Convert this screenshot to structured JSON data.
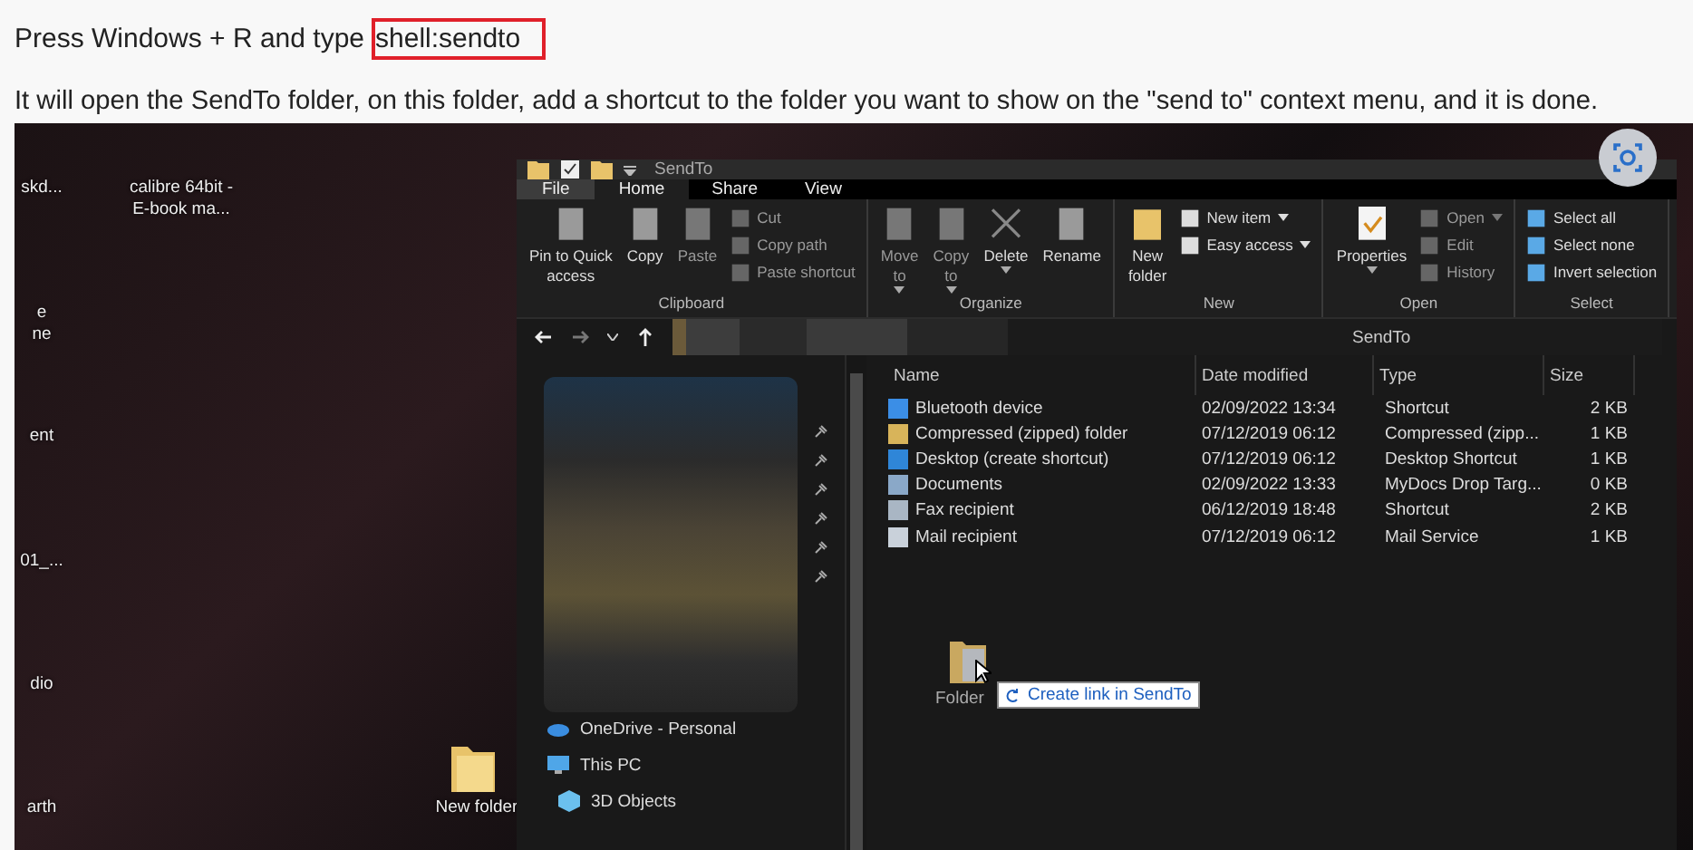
{
  "article": {
    "instruction": "Press Windows + R and type",
    "command": "shell:sendto",
    "paragraph": "It will open the SendTo folder, on this folder, add a shortcut to the folder you want to show on the \"send to\" context menu, and it is done."
  },
  "desktop": {
    "icons": [
      {
        "lines": [
          "skd..."
        ]
      },
      {
        "lines": [
          "calibre 64bit -",
          "E-book ma..."
        ]
      },
      {
        "lines": [
          "e",
          "ne"
        ]
      },
      {
        "lines": [
          "ent"
        ]
      },
      {
        "lines": [
          "01_..."
        ]
      },
      {
        "lines": [
          "dio"
        ]
      },
      {
        "lines": [
          "arth"
        ]
      },
      {
        "lines": [
          "New folder"
        ]
      }
    ]
  },
  "explorer": {
    "title": "SendTo",
    "tabs": [
      {
        "label": "File",
        "kind": "file",
        "selected": false
      },
      {
        "label": "Home",
        "kind": "tab",
        "selected": true
      },
      {
        "label": "Share",
        "kind": "tab",
        "selected": false
      },
      {
        "label": "View",
        "kind": "tab",
        "selected": false
      }
    ],
    "groups": [
      {
        "name": "Clipboard",
        "large": [
          {
            "lines": [
              "Pin to Quick",
              "access"
            ],
            "disabled": false
          },
          {
            "lines": [
              "Copy"
            ],
            "disabled": false
          },
          {
            "lines": [
              "Paste"
            ],
            "disabled": true
          }
        ],
        "small": [
          {
            "label": "Cut",
            "dropdown": false,
            "disabled": true
          },
          {
            "label": "Copy path",
            "dropdown": false,
            "disabled": true
          },
          {
            "label": "Paste shortcut",
            "dropdown": false,
            "disabled": true
          }
        ]
      },
      {
        "name": "Organize",
        "large": [
          {
            "lines": [
              "Move",
              "to"
            ],
            "dropdown": true,
            "disabled": true
          },
          {
            "lines": [
              "Copy",
              "to"
            ],
            "dropdown": true,
            "disabled": true
          },
          {
            "lines": [
              "Delete"
            ],
            "dropdown": true,
            "disabled": false
          },
          {
            "lines": [
              "Rename"
            ],
            "disabled": false
          }
        ]
      },
      {
        "name": "New",
        "large": [
          {
            "lines": [
              "New",
              "folder"
            ],
            "disabled": false
          }
        ],
        "small": [
          {
            "label": "New item",
            "dropdown": true,
            "disabled": false
          },
          {
            "label": "Easy access",
            "dropdown": true,
            "disabled": false
          }
        ]
      },
      {
        "name": "Open",
        "large": [
          {
            "lines": [
              "Properties"
            ],
            "dropdown": true,
            "disabled": false
          }
        ],
        "small": [
          {
            "label": "Open",
            "dropdown": true,
            "disabled": true
          },
          {
            "label": "Edit",
            "dropdown": false,
            "disabled": true
          },
          {
            "label": "History",
            "dropdown": false,
            "disabled": true
          }
        ]
      },
      {
        "name": "Select",
        "small": [
          {
            "label": "Select all",
            "dropdown": false,
            "disabled": false
          },
          {
            "label": "Select none",
            "dropdown": false,
            "disabled": false
          },
          {
            "label": "Invert selection",
            "dropdown": false,
            "disabled": false
          }
        ]
      }
    ],
    "address": "SendTo",
    "columns": [
      "Name",
      "Date modified",
      "Type",
      "Size"
    ],
    "rows": [
      {
        "name": "Bluetooth device",
        "date": "02/09/2022 13:34",
        "type": "Shortcut",
        "size": "2 KB"
      },
      {
        "name": "Compressed (zipped) folder",
        "date": "07/12/2019 06:12",
        "type": "Compressed (zipp...",
        "size": "1 KB"
      },
      {
        "name": "Desktop (create shortcut)",
        "date": "07/12/2019 06:12",
        "type": "Desktop Shortcut",
        "size": "1 KB"
      },
      {
        "name": "Documents",
        "date": "02/09/2022 13:33",
        "type": "MyDocs Drop Targ...",
        "size": "0 KB"
      },
      {
        "name": "Fax recipient",
        "date": "06/12/2019 18:48",
        "type": "Shortcut",
        "size": "2 KB"
      },
      {
        "name": "Mail recipient",
        "date": "07/12/2019 06:12",
        "type": "Mail Service",
        "size": "1 KB"
      }
    ],
    "nav": [
      {
        "label": "OneDrive - Personal",
        "kind": "cloud"
      },
      {
        "label": "This PC",
        "kind": "pc"
      },
      {
        "label": "3D Objects",
        "kind": "cube"
      }
    ],
    "drag": {
      "label": "Folder",
      "tooltip": "Create link in SendTo"
    }
  }
}
